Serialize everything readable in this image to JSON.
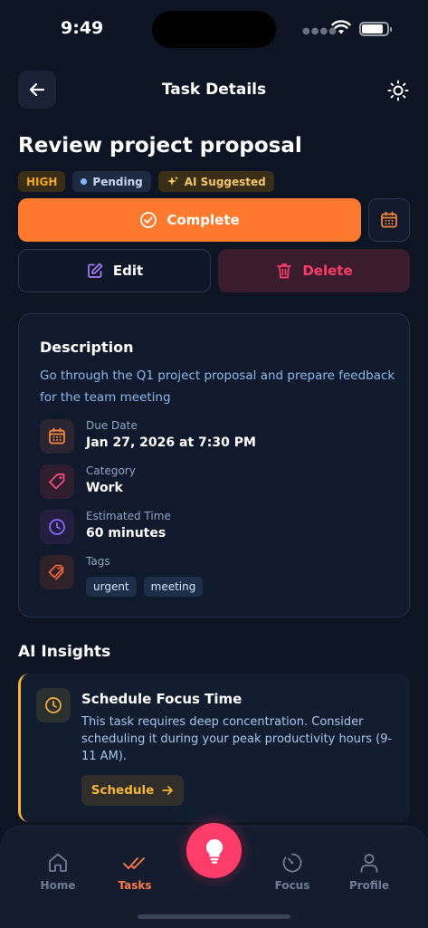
{
  "status_bar": {
    "time": "9:49"
  },
  "header": {
    "title": "Task Details"
  },
  "task": {
    "title": "Review project proposal",
    "priority": "HIGH",
    "status": "Pending",
    "ai_badge": "AI Suggested"
  },
  "actions": {
    "complete_label": "Complete",
    "edit_label": "Edit",
    "delete_label": "Delete"
  },
  "description": {
    "heading": "Description",
    "text": "Go through the Q1 project proposal and prepare feedback for the team meeting",
    "details": [
      {
        "label": "Due Date",
        "value": "Jan 27, 2026 at 7:30 PM",
        "icon": "calendar-icon"
      },
      {
        "label": "Category",
        "value": "Work",
        "icon": "tag-icon"
      },
      {
        "label": "Estimated Time",
        "value": "60 minutes",
        "icon": "clock-icon"
      },
      {
        "label": "Tags",
        "icon": "tags-icon"
      }
    ],
    "tags": [
      "urgent",
      "meeting"
    ]
  },
  "insights": {
    "heading": "AI Insights",
    "card": {
      "title": "Schedule Focus Time",
      "text": "This task requires deep concentration. Consider scheduling it during your peak productivity hours (9-11 AM).",
      "button_label": "Schedule"
    }
  },
  "nav": {
    "items": [
      {
        "label": "Home",
        "icon": "home-icon"
      },
      {
        "label": "Tasks",
        "icon": "tasks-icon"
      },
      {
        "label": "Focus",
        "icon": "focus-icon"
      },
      {
        "label": "Profile",
        "icon": "profile-icon"
      }
    ],
    "active": "Tasks"
  },
  "colors": {
    "background": "#0d1424",
    "accent_orange": "#ff7a2f",
    "danger": "#ff3d6b",
    "insight_accent": "#f5b43a"
  }
}
